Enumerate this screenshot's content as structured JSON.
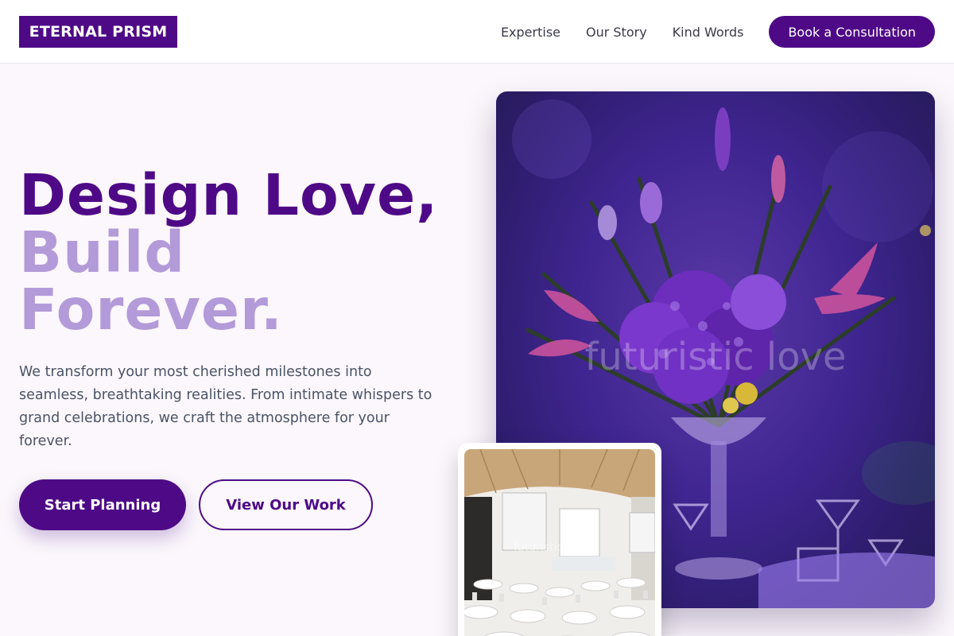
{
  "brand": {
    "name": "ETERNAL PRISM",
    "accent": "#4e0a86",
    "accent_light": "#b39ad9"
  },
  "nav": {
    "links": [
      "Expertise",
      "Our Story",
      "Kind Words"
    ],
    "cta": "Book a Consultation"
  },
  "hero": {
    "headline_line1": "Design Love,",
    "headline_line2": "Build",
    "headline_line3": "Forever.",
    "intro": "We transform your most cherished milestones into seamless, breathtaking realities. From intimate whispers to grand celebrations, we craft the atmosphere for your forever.",
    "primary_button": "Start Planning",
    "secondary_button": "View Our Work"
  },
  "images": {
    "main_watermark": "futuristic love",
    "venue_watermark": "futuristic love"
  }
}
